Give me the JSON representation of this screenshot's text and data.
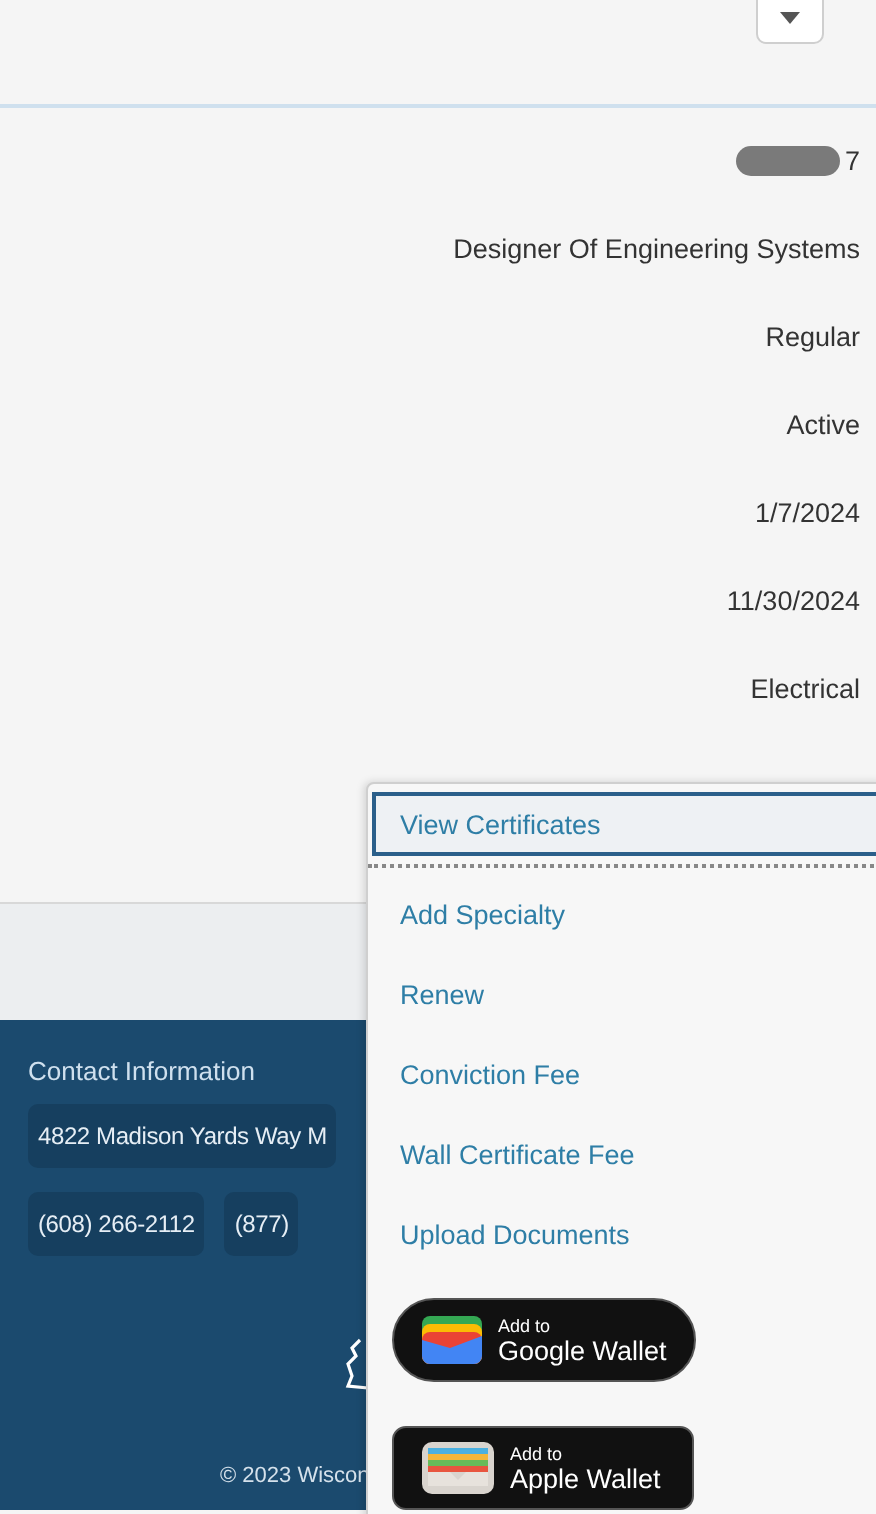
{
  "details": {
    "values": [
      {
        "text": "7",
        "redacted": true
      },
      {
        "text": "Designer Of Engineering Systems",
        "redacted": false
      },
      {
        "text": "Regular",
        "redacted": false
      },
      {
        "text": "Active",
        "redacted": false
      },
      {
        "text": "1/7/2024",
        "redacted": false
      },
      {
        "text": "11/30/2024",
        "redacted": false
      },
      {
        "text": "Electrical",
        "redacted": false
      }
    ]
  },
  "footer": {
    "heading": "Contact Information",
    "address": "4822 Madison Yards Way M",
    "phones": [
      "(608) 266-2112",
      "(877)"
    ],
    "copyright": "© 2023 Wiscon"
  },
  "menu": {
    "items": [
      {
        "label": "View Certificates",
        "selected": true
      },
      {
        "label": "Add Specialty",
        "selected": false
      },
      {
        "label": "Renew",
        "selected": false
      },
      {
        "label": "Conviction Fee",
        "selected": false
      },
      {
        "label": "Wall Certificate Fee",
        "selected": false
      },
      {
        "label": "Upload Documents",
        "selected": false
      }
    ],
    "wallet_buttons": [
      {
        "kind": "google",
        "line1": "Add to",
        "line2": "Google Wallet"
      },
      {
        "kind": "apple",
        "line1": "Add to",
        "line2": "Apple Wallet"
      }
    ]
  }
}
